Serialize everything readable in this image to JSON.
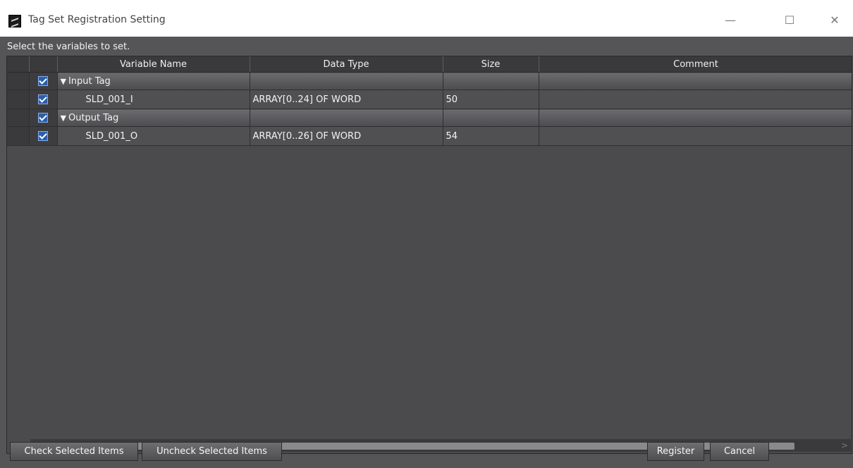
{
  "window": {
    "title": "Tag Set Registration Setting",
    "minimize_glyph": "—",
    "maximize_glyph": "☐",
    "close_glyph": "✕"
  },
  "instruction": "Select the variables to set.",
  "table": {
    "columns": [
      "Variable Name",
      "Data Type",
      "Size",
      "Comment"
    ],
    "rows": [
      {
        "type": "group",
        "checked": true,
        "name": "Input Tag",
        "data_type": "",
        "size": "",
        "comment": ""
      },
      {
        "type": "item",
        "checked": true,
        "name": "SLD_001_I",
        "data_type": "ARRAY[0..24] OF WORD",
        "size": "50",
        "comment": ""
      },
      {
        "type": "group",
        "checked": true,
        "name": "Output Tag",
        "data_type": "",
        "size": "",
        "comment": ""
      },
      {
        "type": "item",
        "checked": true,
        "name": "SLD_001_O",
        "data_type": "ARRAY[0..26] OF WORD",
        "size": "54",
        "comment": ""
      }
    ]
  },
  "buttons": {
    "check_selected": "Check Selected Items",
    "uncheck_selected": "Uncheck Selected Items",
    "register": "Register",
    "cancel": "Cancel"
  },
  "scroll": {
    "left_arrow": "<",
    "right_arrow": ">"
  },
  "colors": {
    "checkbox": "#2a5fb0",
    "background": "#555558"
  }
}
